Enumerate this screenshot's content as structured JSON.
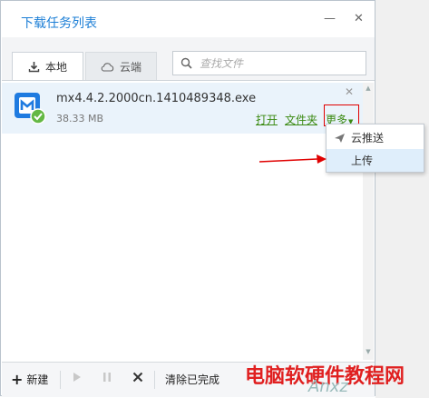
{
  "window": {
    "title": "下载任务列表",
    "minimize_glyph": "—",
    "close_glyph": "✕"
  },
  "tabs": [
    {
      "label": "本地",
      "icon": "download-icon"
    },
    {
      "label": "云端",
      "icon": "cloud-icon"
    }
  ],
  "search": {
    "placeholder": "查找文件"
  },
  "downloads": [
    {
      "filename": "mx4.4.2.2000cn.1410489348.exe",
      "size": "38.33 MB",
      "actions": {
        "open": "打开",
        "folder": "文件夹",
        "more": "更多"
      }
    }
  ],
  "context_menu": {
    "items": [
      {
        "label": "云推送",
        "icon": "send-icon"
      },
      {
        "label": "上传",
        "icon": ""
      }
    ]
  },
  "bottom_bar": {
    "new_label": "新建",
    "clear_label": "清除已完成"
  },
  "watermark": {
    "text": "电脑软硬件教程网",
    "sub": "Anxz"
  },
  "colors": {
    "title": "#1d7fd6",
    "link": "#3b8a12",
    "highlight": "#e00000"
  }
}
